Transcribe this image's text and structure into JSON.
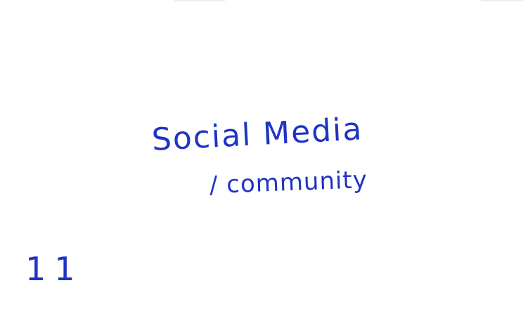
{
  "note": {
    "line1": "Social Media",
    "line2": "/ community",
    "mark": "11"
  },
  "colors": {
    "ink": "#1f33c4",
    "paper": "#ffffff"
  }
}
